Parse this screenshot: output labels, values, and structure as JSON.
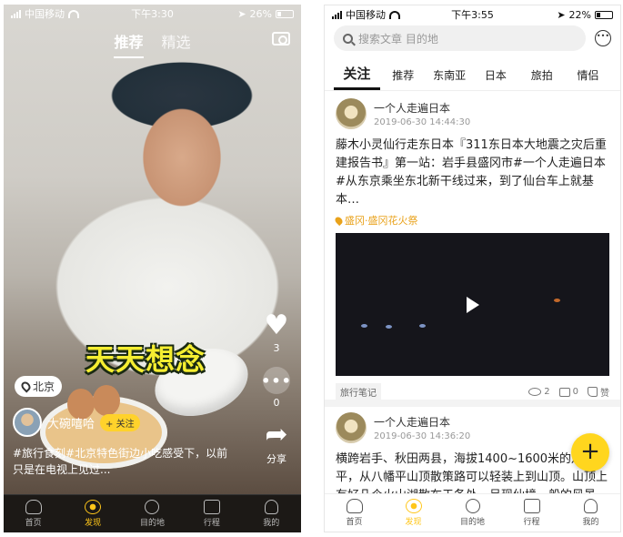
{
  "left": {
    "status": {
      "carrier": "中国移动",
      "time": "下午3:30",
      "battery": "26%"
    },
    "top_tabs": [
      "推荐",
      "精选"
    ],
    "caption_overlay": "天天想念",
    "location": "北京",
    "author_name": "大碗嘻哈",
    "follow_label": "+ 关注",
    "description": "#旅行食刻#北京特色街边小吃感受下，以前只是在电视上见过...",
    "likes": "3",
    "comments": "0",
    "share_label": "分享",
    "icons": {
      "like": "heart-icon",
      "comment": "more-icon",
      "share": "share-icon",
      "camera": "camera-icon"
    }
  },
  "tabbar": [
    "首页",
    "发现",
    "目的地",
    "行程",
    "我的"
  ],
  "right": {
    "status": {
      "carrier": "中国移动",
      "time": "下午3:55",
      "battery": "22%"
    },
    "search_placeholder": "搜索文章 目的地",
    "categories": [
      "关注",
      "推荐",
      "东南亚",
      "日本",
      "旅拍",
      "情侣"
    ],
    "posts": [
      {
        "author": "一个人走遍日本",
        "time": "2019-06-30 14:44:30",
        "text": "藤木小灵仙行走东日本『311东日本大地震之灾后重建报告书』第一站：岩手县盛冈市#一个人走遍日本#从东京乘坐东北新干线过来，到了仙台车上就基本…",
        "location": "盛冈·盛冈花火祭",
        "tag": "旅行笔记",
        "views": "2",
        "comments": "0",
        "like_label": "赞"
      },
      {
        "author": "一个人走遍日本",
        "time": "2019-06-30 14:36:20",
        "text": "横跨岩手、秋田两县，海拔1400~1600米的八幡平，从八幡平山顶散策路可以轻装上到山顶。山顶上有好几个火山湖散布于各处，呈现仙境一般的风景。在…"
      }
    ],
    "fab_label": "+"
  },
  "colors": {
    "accent": "#ffc61a",
    "follow": "#ffd22b",
    "caption": "#f5ee31",
    "location": "#e9a21b"
  }
}
